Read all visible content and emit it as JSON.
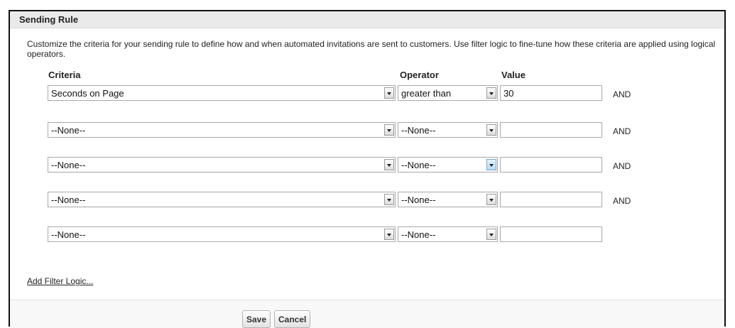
{
  "section": {
    "title": "Sending Rule",
    "description": "Customize the criteria for your sending rule to define how and when automated invitations are sent to customers. Use filter logic to fine-tune how these criteria are applied using logical operators."
  },
  "columns": {
    "criteria": "Criteria",
    "operator": "Operator",
    "value": "Value"
  },
  "rows": [
    {
      "criteria": "Seconds on Page",
      "operator": "greater than",
      "value": "30",
      "connector": "AND"
    },
    {
      "criteria": "--None--",
      "operator": "--None--",
      "value": "",
      "connector": "AND"
    },
    {
      "criteria": "--None--",
      "operator": "--None--",
      "value": "",
      "connector": "AND"
    },
    {
      "criteria": "--None--",
      "operator": "--None--",
      "value": "",
      "connector": "AND"
    },
    {
      "criteria": "--None--",
      "operator": "--None--",
      "value": "",
      "connector": ""
    }
  ],
  "add_filter_logic": "Add Filter Logic...",
  "buttons": {
    "save": "Save",
    "cancel": "Cancel"
  }
}
